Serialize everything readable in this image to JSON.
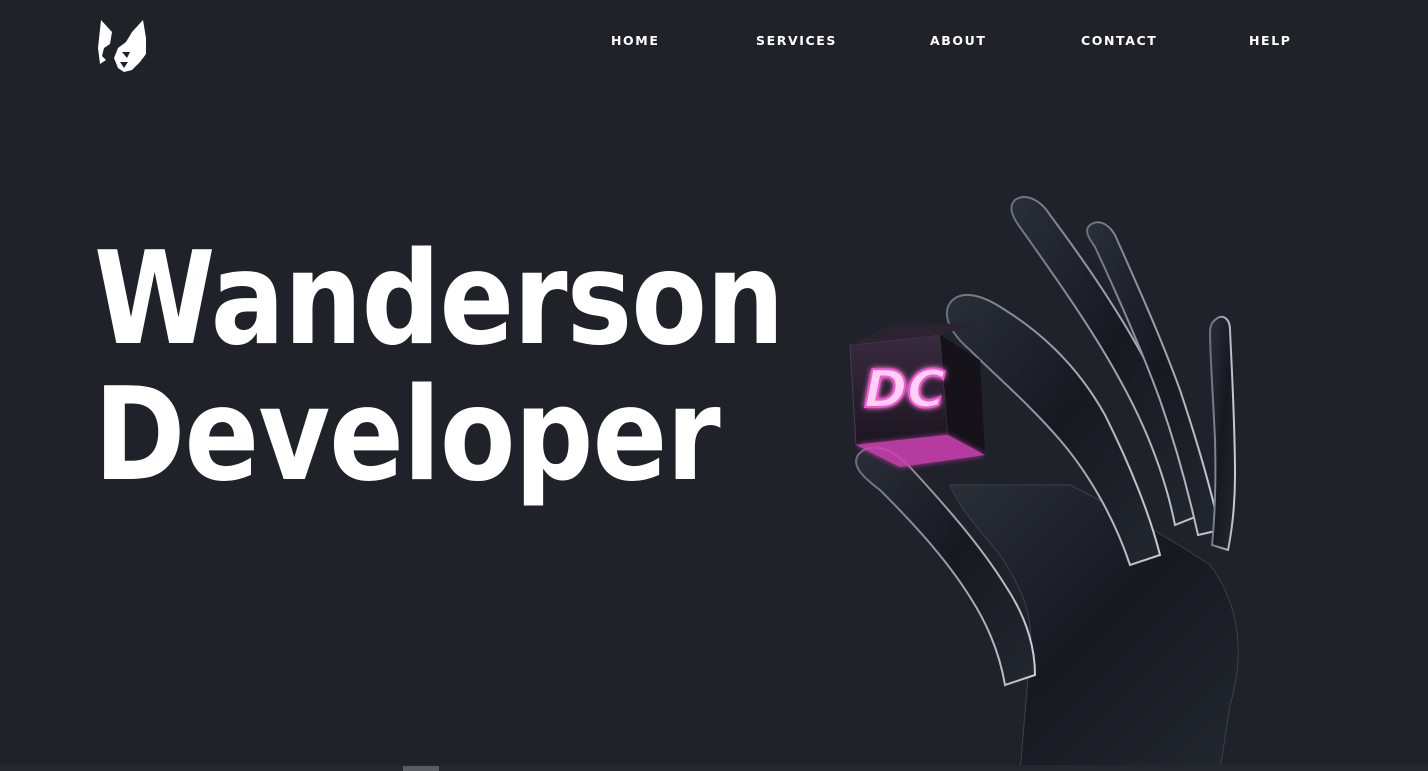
{
  "logo": {
    "icon": "wolf-head-icon"
  },
  "nav": {
    "items": [
      {
        "label": "HOME"
      },
      {
        "label": "SERVICES"
      },
      {
        "label": "ABOUT"
      },
      {
        "label": "CONTACT"
      },
      {
        "label": "HELP"
      }
    ]
  },
  "hero": {
    "title_line1": "Wanderson",
    "title_line2": "Developer",
    "cube_label": "DC",
    "illustration_icon": "hand-holding-cube-icon"
  },
  "colors": {
    "background": "#1f2229",
    "text": "#ffffff",
    "neon_accent": "#ff4fd8"
  }
}
